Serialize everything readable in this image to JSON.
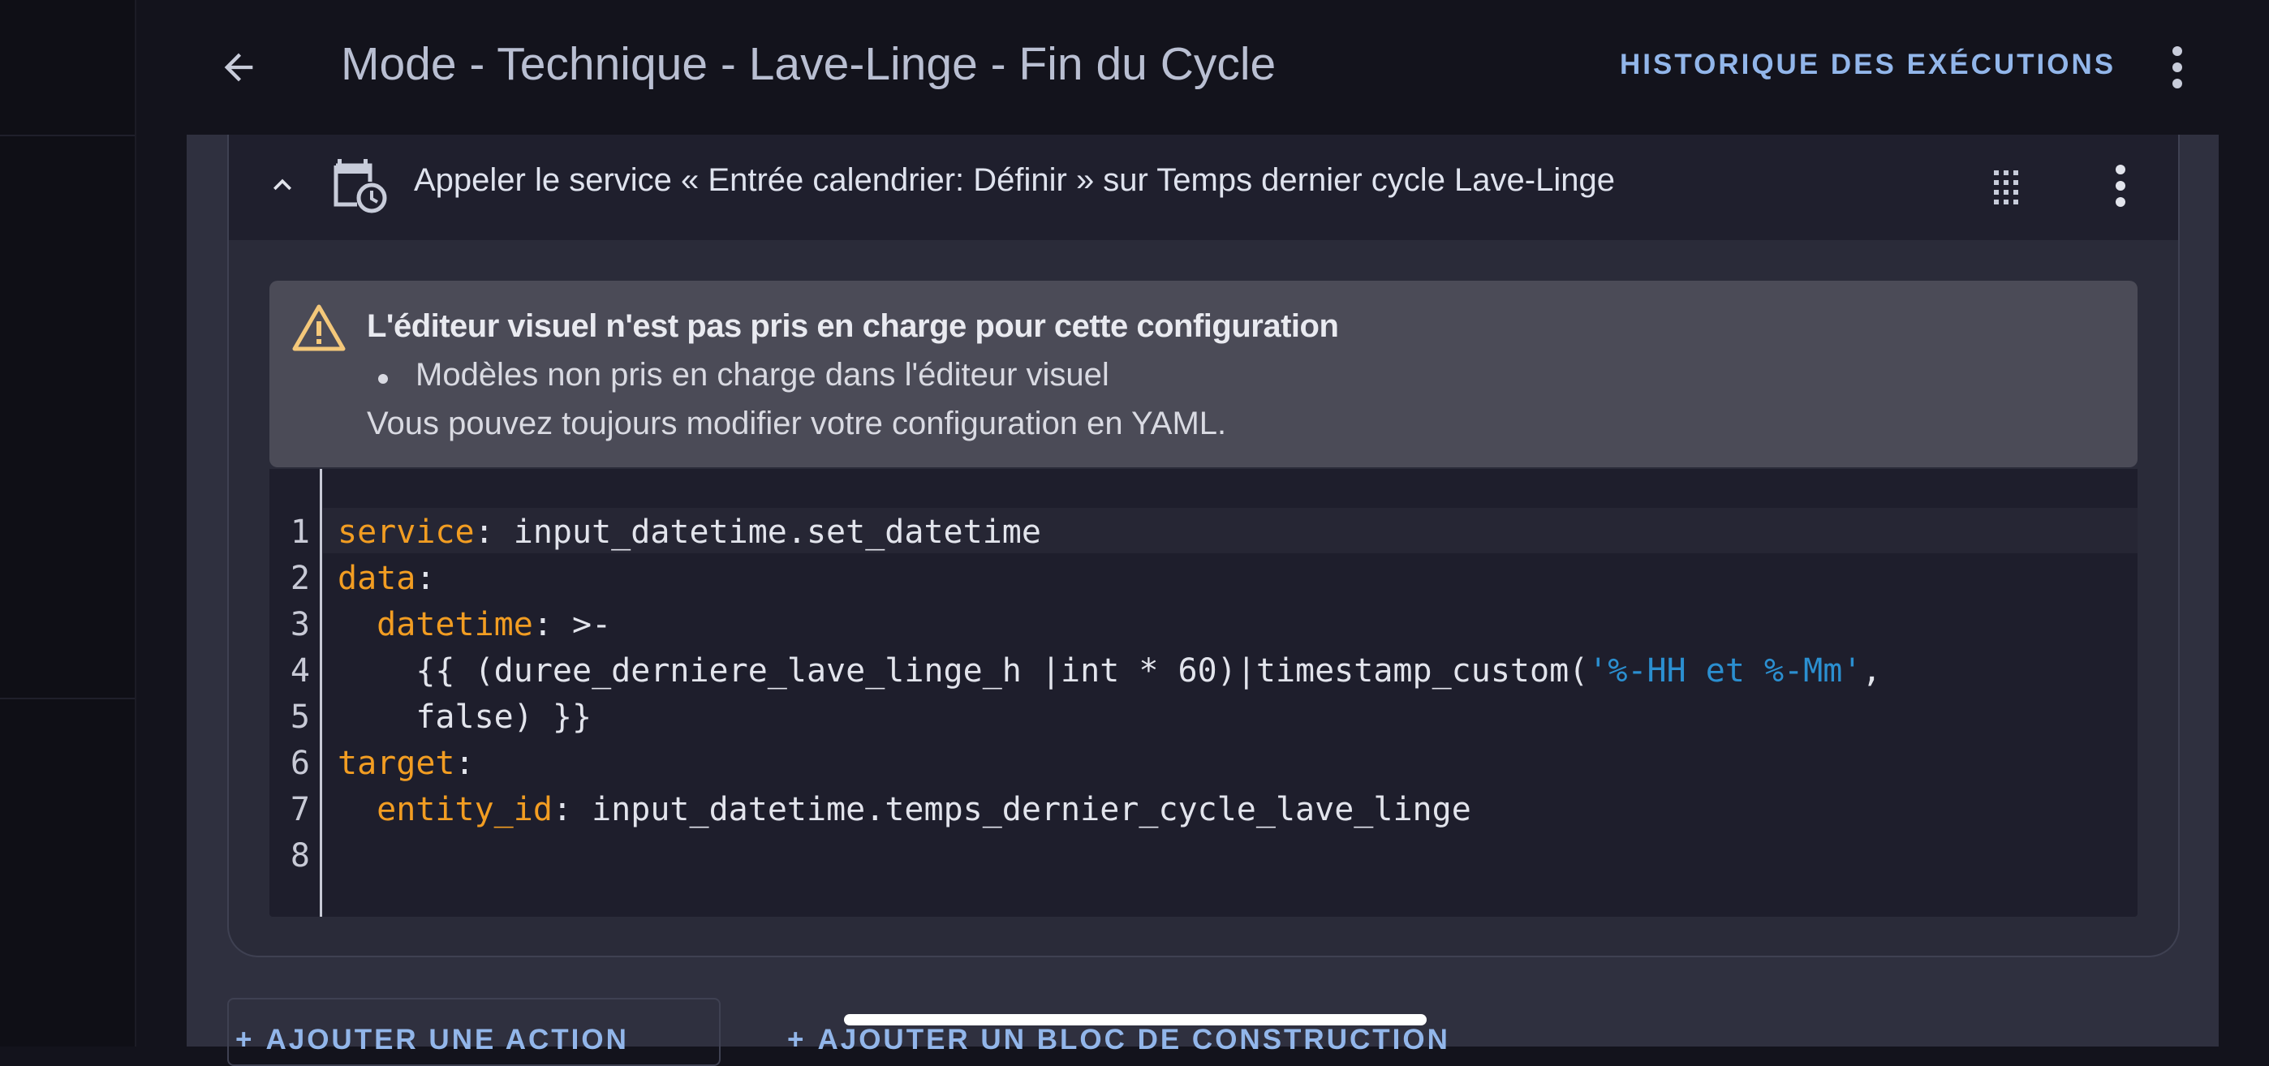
{
  "header": {
    "title": "Mode - Technique - Lave-Linge - Fin du Cycle",
    "history_label": "HISTORIQUE DES EXÉCUTIONS"
  },
  "action_card": {
    "title": "Appeler le service « Entrée calendrier: Définir » sur Temps dernier cycle Lave-Linge",
    "icon": "calendar-clock-icon"
  },
  "warning": {
    "title": "L'éditeur visuel n'est pas pris en charge pour cette configuration",
    "items": [
      "Modèles non pris en charge dans l'éditeur visuel"
    ],
    "footer": "Vous pouvez toujours modifier votre configuration en YAML."
  },
  "yaml": {
    "line_numbers": [
      "1",
      "2",
      "3",
      "4",
      "5",
      "6",
      "7",
      "8"
    ],
    "l1_key": "service",
    "l1_val": ": input_datetime.set_datetime",
    "l2_key": "data",
    "l2_val": ":",
    "l3_indent": "  ",
    "l3_key": "datetime",
    "l3_val": ": >-",
    "l4_pre": "    {{ (duree_derniere_lave_linge_h |int * 60)|timestamp_custom(",
    "l4_str": "'%-HH et %-Mm'",
    "l4_post": ",",
    "l5": "    false) }}",
    "l6_key": "target",
    "l6_val": ":",
    "l7_indent": "  ",
    "l7_key": "entity_id",
    "l7_val": ": input_datetime.temps_dernier_cycle_lave_linge"
  },
  "footer_buttons": {
    "add_action": "AJOUTER UNE ACTION",
    "add_block": "AJOUTER UN BLOC DE CONSTRUCTION"
  },
  "colors": {
    "accent": "#92b6ea",
    "yaml_key": "#f29d22",
    "yaml_string": "#2b8fd0",
    "warning_icon": "#f4c87a"
  }
}
